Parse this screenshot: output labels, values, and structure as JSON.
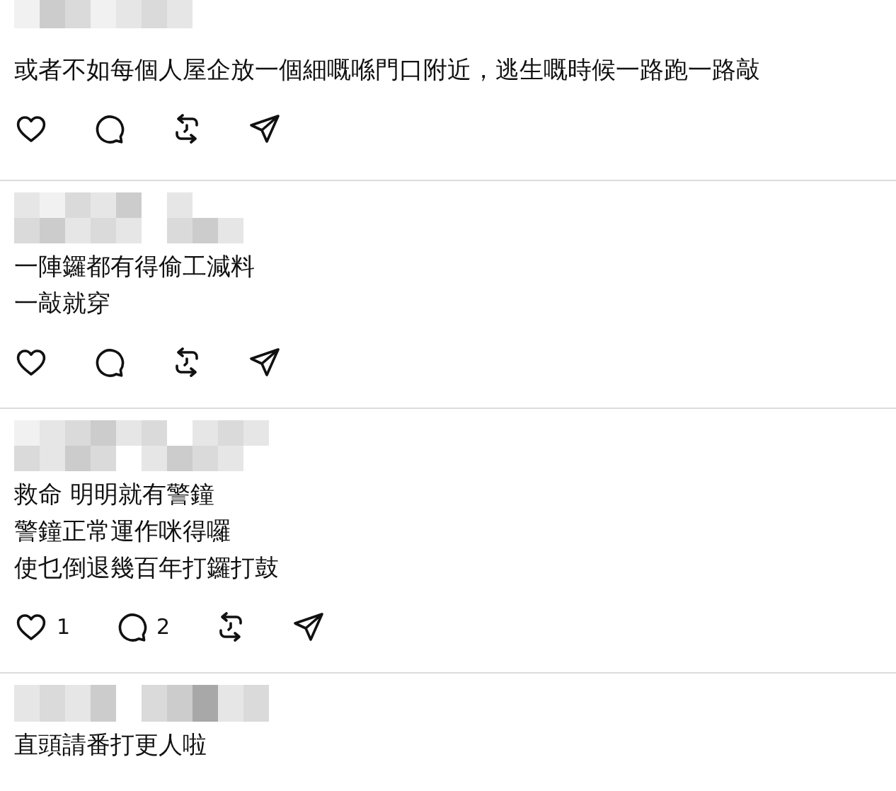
{
  "posts": [
    {
      "lines": [
        "或者不如每個人屋企放一個細嘅喺門口附近，逃生嘅時候一路跑一路敲"
      ],
      "actions": [
        {
          "kind": "like"
        },
        {
          "kind": "reply"
        },
        {
          "kind": "repost"
        },
        {
          "kind": "share"
        }
      ]
    },
    {
      "lines": [
        "一陣鑼都有得偷工減料",
        "一敲就穿"
      ],
      "actions": [
        {
          "kind": "like"
        },
        {
          "kind": "reply"
        },
        {
          "kind": "repost"
        },
        {
          "kind": "share"
        }
      ]
    },
    {
      "lines": [
        "救命 明明就有警鐘",
        "警鐘正常運作咪得囉",
        "使乜倒退幾百年打鑼打鼓"
      ],
      "actions": [
        {
          "kind": "like",
          "count": "1"
        },
        {
          "kind": "reply",
          "count": "2"
        },
        {
          "kind": "repost"
        },
        {
          "kind": "share"
        }
      ]
    },
    {
      "lines": [
        "直頭請番打更人啦"
      ]
    }
  ]
}
